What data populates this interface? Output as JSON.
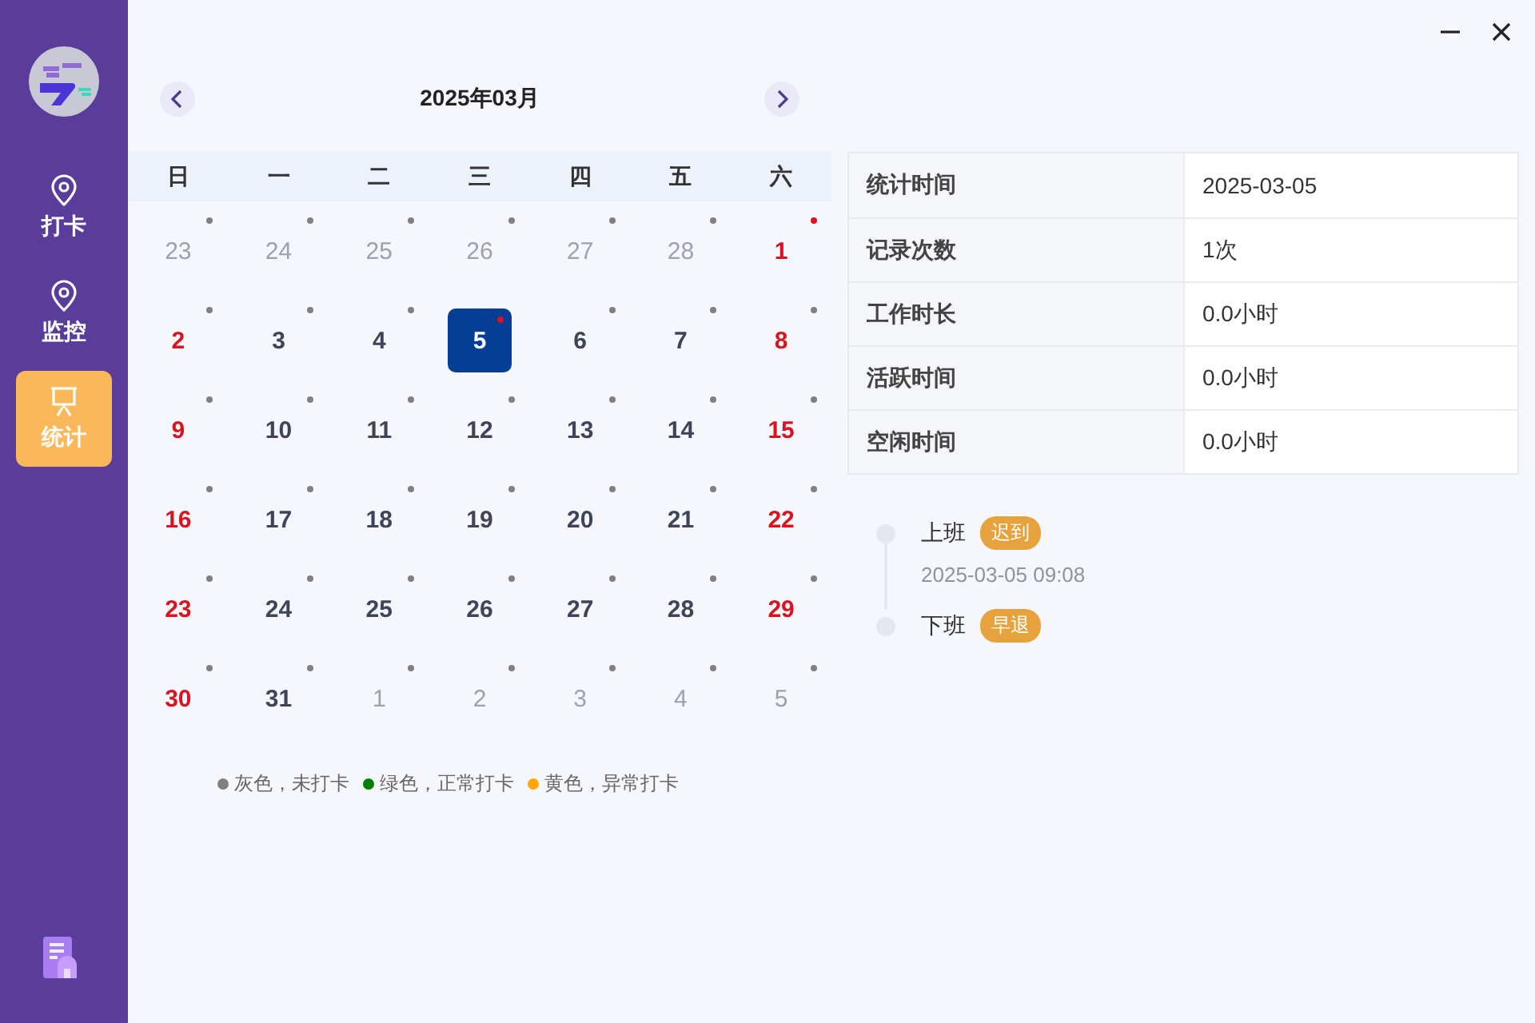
{
  "sidebar": {
    "items": [
      {
        "label": "打卡",
        "kind": "pin",
        "selected": false
      },
      {
        "label": "监控",
        "kind": "pin",
        "selected": false
      },
      {
        "label": "统计",
        "kind": "easel",
        "selected": true
      }
    ]
  },
  "calendar": {
    "title": "2025年03月",
    "weekdays": [
      "日",
      "一",
      "二",
      "三",
      "四",
      "五",
      "六"
    ],
    "days": [
      {
        "text": "23",
        "kind": "other",
        "selected": false,
        "color": "#808080"
      },
      {
        "text": "24",
        "kind": "other",
        "selected": false,
        "color": "#808080"
      },
      {
        "text": "25",
        "kind": "other",
        "selected": false,
        "color": "#808080"
      },
      {
        "text": "26",
        "kind": "other",
        "selected": false,
        "color": "#808080"
      },
      {
        "text": "27",
        "kind": "other",
        "selected": false,
        "color": "#808080"
      },
      {
        "text": "28",
        "kind": "other",
        "selected": false,
        "color": "#808080"
      },
      {
        "text": "1",
        "kind": "weekend",
        "selected": false,
        "color": "#e0101e"
      },
      {
        "text": "2",
        "kind": "weekend",
        "selected": false,
        "color": "#808080"
      },
      {
        "text": "3",
        "kind": "weekday",
        "selected": false,
        "color": "#808080"
      },
      {
        "text": "4",
        "kind": "weekday",
        "selected": false,
        "color": "#808080"
      },
      {
        "text": "5",
        "kind": "weekday",
        "selected": true,
        "color": "#e0101e"
      },
      {
        "text": "6",
        "kind": "weekday",
        "selected": false,
        "color": "#808080"
      },
      {
        "text": "7",
        "kind": "weekday",
        "selected": false,
        "color": "#808080"
      },
      {
        "text": "8",
        "kind": "weekend",
        "selected": false,
        "color": "#808080"
      },
      {
        "text": "9",
        "kind": "weekend",
        "selected": false,
        "color": "#808080"
      },
      {
        "text": "10",
        "kind": "weekday",
        "selected": false,
        "color": "#808080"
      },
      {
        "text": "11",
        "kind": "weekday",
        "selected": false,
        "color": "#808080"
      },
      {
        "text": "12",
        "kind": "weekday",
        "selected": false,
        "color": "#808080"
      },
      {
        "text": "13",
        "kind": "weekday",
        "selected": false,
        "color": "#808080"
      },
      {
        "text": "14",
        "kind": "weekday",
        "selected": false,
        "color": "#808080"
      },
      {
        "text": "15",
        "kind": "weekend",
        "selected": false,
        "color": "#808080"
      },
      {
        "text": "16",
        "kind": "weekend",
        "selected": false,
        "color": "#808080"
      },
      {
        "text": "17",
        "kind": "weekday",
        "selected": false,
        "color": "#808080"
      },
      {
        "text": "18",
        "kind": "weekday",
        "selected": false,
        "color": "#808080"
      },
      {
        "text": "19",
        "kind": "weekday",
        "selected": false,
        "color": "#808080"
      },
      {
        "text": "20",
        "kind": "weekday",
        "selected": false,
        "color": "#808080"
      },
      {
        "text": "21",
        "kind": "weekday",
        "selected": false,
        "color": "#808080"
      },
      {
        "text": "22",
        "kind": "weekend",
        "selected": false,
        "color": "#808080"
      },
      {
        "text": "23",
        "kind": "weekend",
        "selected": false,
        "color": "#808080"
      },
      {
        "text": "24",
        "kind": "weekday",
        "selected": false,
        "color": "#808080"
      },
      {
        "text": "25",
        "kind": "weekday",
        "selected": false,
        "color": "#808080"
      },
      {
        "text": "26",
        "kind": "weekday",
        "selected": false,
        "color": "#808080"
      },
      {
        "text": "27",
        "kind": "weekday",
        "selected": false,
        "color": "#808080"
      },
      {
        "text": "28",
        "kind": "weekday",
        "selected": false,
        "color": "#808080"
      },
      {
        "text": "29",
        "kind": "weekend",
        "selected": false,
        "color": "#808080"
      },
      {
        "text": "30",
        "kind": "weekend",
        "selected": false,
        "color": "#808080"
      },
      {
        "text": "31",
        "kind": "weekday",
        "selected": false,
        "color": "#808080"
      },
      {
        "text": "1",
        "kind": "other",
        "selected": false,
        "color": "#808080"
      },
      {
        "text": "2",
        "kind": "other",
        "selected": false,
        "color": "#808080"
      },
      {
        "text": "3",
        "kind": "other",
        "selected": false,
        "color": "#808080"
      },
      {
        "text": "4",
        "kind": "other",
        "selected": false,
        "color": "#808080"
      },
      {
        "text": "5",
        "kind": "other",
        "selected": false,
        "color": "#808080"
      }
    ],
    "legend": [
      {
        "text": "灰色，未打卡",
        "color": "#808080"
      },
      {
        "text": "绿色，正常打卡",
        "color": "#008000"
      },
      {
        "text": "黄色，异常打卡",
        "color": "#ffa500"
      }
    ]
  },
  "stats": [
    {
      "label": "统计时间",
      "value": "2025-03-05"
    },
    {
      "label": "记录次数",
      "value": "1次"
    },
    {
      "label": "工作时长",
      "value": "0.0小时"
    },
    {
      "label": "活跃时间",
      "value": "0.0小时"
    },
    {
      "label": "空闲时间",
      "value": "0.0小时"
    }
  ],
  "timeline": [
    {
      "title": "上班",
      "tag": "迟到",
      "time": "2025-03-05 09:08"
    },
    {
      "title": "下班",
      "tag": "早退"
    }
  ]
}
